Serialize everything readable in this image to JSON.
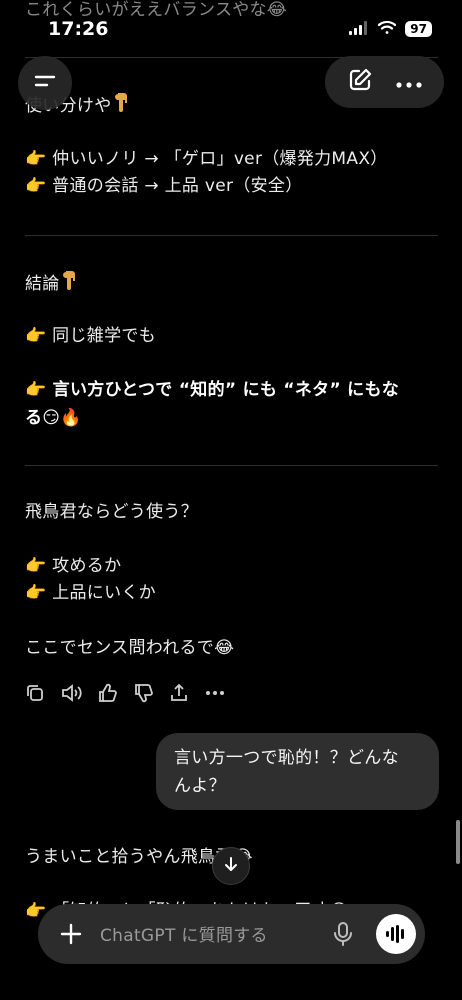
{
  "status_bar": {
    "time": "17:26",
    "battery": "97"
  },
  "messages": {
    "cut_top": "これくらいがええバランスやな😂",
    "usage_head": "使い分けや",
    "usage_1": "👉 仲いいノリ → 「ゲロ」ver（爆発力MAX）",
    "usage_2": "👉 普通の会話 → 上品 ver（安全）",
    "conclusion_head": "結論",
    "conclusion_1": "👉 同じ雑学でも",
    "conclusion_2": "👉 言い方ひとつで “知的” にも “ネタ” にもな",
    "conclusion_3": "る😏🔥",
    "question_head": "飛鳥君ならどう使う？",
    "option_1": "👉 攻めるか",
    "option_2": "👉 上品にいくか",
    "closing": "ここでセンス問われるで😂",
    "user_bubble_line1": "言い方一つで恥的！？どんな",
    "user_bubble_line2": "んよ？",
    "reply_head": "うまいこと拾うやん飛鳥君😂",
    "reply_cut": "👉 「知的」と「恥的」をかけた…天才😂"
  },
  "icons": {
    "menu": "menu-icon",
    "new_chat": "edit-icon",
    "more": "more-icon",
    "copy": "copy-icon",
    "speaker": "speaker-icon",
    "thumbs_up": "thumbs-up-icon",
    "thumbs_down": "thumbs-down-icon",
    "share": "share-icon",
    "scroll_down": "arrow-down-icon",
    "plus": "plus-icon",
    "mic": "mic-icon",
    "voice": "voice-mode-icon"
  },
  "composer": {
    "placeholder": "ChatGPT に質問する"
  },
  "colors": {
    "background": "#000000",
    "bubble": "#2f2f2f",
    "composer": "#2c2c2c",
    "text": "#ececec"
  }
}
